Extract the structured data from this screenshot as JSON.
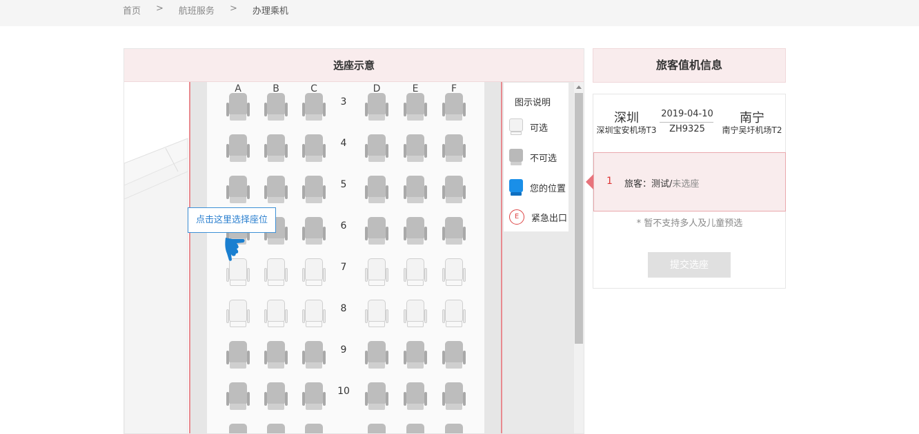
{
  "breadcrumb": [
    "首页",
    ">",
    "航班服务",
    ">",
    "办理乘机"
  ],
  "seat_map": {
    "title": "选座示意",
    "columns": [
      "A",
      "B",
      "C",
      "D",
      "E",
      "F"
    ],
    "rows": [
      {
        "row": "3",
        "seats": [
          "taken",
          "taken",
          "taken",
          "taken",
          "taken",
          "taken"
        ]
      },
      {
        "row": "4",
        "seats": [
          "taken",
          "taken",
          "taken",
          "taken",
          "taken",
          "taken"
        ]
      },
      {
        "row": "5",
        "seats": [
          "taken",
          "taken",
          "taken",
          "taken",
          "taken",
          "taken"
        ]
      },
      {
        "row": "6",
        "seats": [
          "taken",
          "taken",
          "taken",
          "taken",
          "taken",
          "taken"
        ]
      },
      {
        "row": "7",
        "seats": [
          "free",
          "free",
          "free",
          "free",
          "free",
          "free"
        ]
      },
      {
        "row": "8",
        "seats": [
          "free",
          "free",
          "free",
          "free",
          "free",
          "free"
        ]
      },
      {
        "row": "9",
        "seats": [
          "taken",
          "taken",
          "taken",
          "taken",
          "taken",
          "taken"
        ]
      },
      {
        "row": "10",
        "seats": [
          "taken",
          "taken",
          "taken",
          "taken",
          "taken",
          "taken"
        ]
      },
      {
        "row": "",
        "seats": [
          "taken",
          "taken",
          "taken",
          "taken",
          "taken",
          "taken"
        ]
      }
    ],
    "tooltip": "点击这里选择座位",
    "legend": {
      "title": "图示说明",
      "available": "可选",
      "unavailable": "不可选",
      "your_position": "您的位置",
      "emergency_exit": "紧急出口",
      "exit_icon_letter": "E"
    }
  },
  "passenger_panel": {
    "title": "旅客值机信息",
    "origin_city": "深圳",
    "origin_airport": "深圳宝安机场T3",
    "destination_city": "南宁",
    "destination_airport": "南宁吴圩机场T2",
    "date": "2019-04-10",
    "flight_no": "ZH9325",
    "passenger_index": "1",
    "passenger_label": "旅客：测试/",
    "passenger_status": "未选座",
    "note": "* 暂不支持多人及儿童预选",
    "submit_label": "提交选座"
  },
  "colors": {
    "accent_pink": "#f9eced",
    "fuselage_red": "#e88a8f",
    "your_seat_blue": "#1a8fe8",
    "tooltip_blue": "#2a7fcf"
  }
}
